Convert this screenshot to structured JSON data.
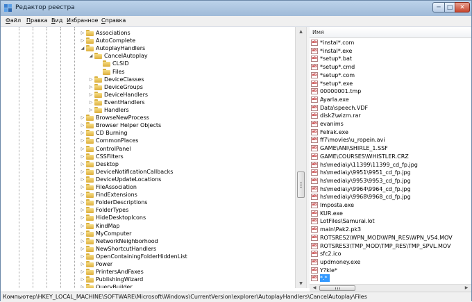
{
  "window": {
    "title": "Редактор реестра",
    "icon": "regedit-icon",
    "controls": {
      "minimize": "─",
      "maximize": "□",
      "close": "✕"
    }
  },
  "menu": [
    "Файл",
    "Правка",
    "Вид",
    "Избранное",
    "Справка"
  ],
  "tree": {
    "items": [
      {
        "label": "Associations",
        "expander": "▷",
        "open": false
      },
      {
        "label": "AutoComplete",
        "expander": "▷",
        "open": false
      },
      {
        "label": "AutoplayHandlers",
        "expander": "◢",
        "open": true
      },
      {
        "label": "CancelAutoplay",
        "expander": "◢",
        "open": true
      },
      {
        "label": "CLSID",
        "expander": "",
        "open": false
      },
      {
        "label": "Files",
        "expander": "",
        "open": true
      },
      {
        "label": "DeviceClasses",
        "expander": "▷",
        "open": false
      },
      {
        "label": "DeviceGroups",
        "expander": "▷",
        "open": false
      },
      {
        "label": "DeviceHandlers",
        "expander": "▷",
        "open": false
      },
      {
        "label": "EventHandlers",
        "expander": "▷",
        "open": false
      },
      {
        "label": "Handlers",
        "expander": "▷",
        "open": false
      },
      {
        "label": "BrowseNewProcess",
        "expander": "▷",
        "open": false
      },
      {
        "label": "Browser Helper Objects",
        "expander": "▷",
        "open": false
      },
      {
        "label": "CD Burning",
        "expander": "▷",
        "open": false
      },
      {
        "label": "CommonPlaces",
        "expander": "▷",
        "open": false
      },
      {
        "label": "ControlPanel",
        "expander": "▷",
        "open": false
      },
      {
        "label": "CSSFilters",
        "expander": "▷",
        "open": false
      },
      {
        "label": "Desktop",
        "expander": "▷",
        "open": false
      },
      {
        "label": "DeviceNotificationCallbacks",
        "expander": "▷",
        "open": false
      },
      {
        "label": "DeviceUpdateLocations",
        "expander": "▷",
        "open": false
      },
      {
        "label": "FileAssociation",
        "expander": "▷",
        "open": false
      },
      {
        "label": "FindExtensions",
        "expander": "▷",
        "open": false
      },
      {
        "label": "FolderDescriptions",
        "expander": "▷",
        "open": false
      },
      {
        "label": "FolderTypes",
        "expander": "▷",
        "open": false
      },
      {
        "label": "HideDesktopIcons",
        "expander": "▷",
        "open": false
      },
      {
        "label": "KindMap",
        "expander": "▷",
        "open": false
      },
      {
        "label": "MyComputer",
        "expander": "▷",
        "open": false
      },
      {
        "label": "NetworkNeighborhood",
        "expander": "▷",
        "open": false
      },
      {
        "label": "NewShortcutHandlers",
        "expander": "▷",
        "open": false
      },
      {
        "label": "OpenContainingFolderHiddenList",
        "expander": "▷",
        "open": false
      },
      {
        "label": "Power",
        "expander": "▷",
        "open": false
      },
      {
        "label": "PrintersAndFaxes",
        "expander": "▷",
        "open": false
      },
      {
        "label": "PublishingWizard",
        "expander": "▷",
        "open": false
      },
      {
        "label": "QueryBuilder",
        "expander": "▷",
        "open": false
      },
      {
        "label": "RecentDocs",
        "expander": "▷",
        "open": false
      }
    ],
    "scroll": {
      "up": "▲",
      "down": "▼"
    }
  },
  "list": {
    "column_name": "Имя",
    "value_icon_text": "ab",
    "values": [
      "*instal*.com",
      "*instal*.exe",
      "*setup*.bat",
      "*setup*.cmd",
      "*setup*.com",
      "*setup*.exe",
      "00000001.tmp",
      "Ayarla.exe",
      "Data\\speech.VDF",
      "disk2\\wizm.rar",
      "evanims",
      "Felrak.exe",
      "ff7\\movies\\u_ropein.avi",
      "GAME\\ANI\\SHIRLE_1.SSF",
      "GAME\\COURSES\\WHISTLER.CRZ",
      "hs\\media\\y\\11399\\11399_cd_fp.jpg",
      "hs\\media\\y\\9951\\9951_cd_fp.jpg",
      "hs\\media\\y\\9953\\9953_cd_fp.jpg",
      "hs\\media\\y\\9964\\9964_cd_fp.jpg",
      "hs\\media\\y\\9968\\9968_cd_fp.jpg",
      "Imposta.exe",
      "KUR.exe",
      "LotFiles\\Samurai.lot",
      "main\\Pak2.pk3",
      "ROTSRES2\\WPN_MOD\\WPN_RES\\WPN_V54.MOV",
      "ROTSRES3\\TMP_MOD\\TMP_RES\\TMP_SPVL.MOV",
      "sfc2.ico",
      "updmoney.exe",
      "Y?kle*"
    ],
    "selected_label": "*.*",
    "hscroll": {
      "left": "◀",
      "right": "▶",
      "grip": "|||"
    }
  },
  "status": "Компьютер\\HKEY_LOCAL_MACHINE\\SOFTWARE\\Microsoft\\Windows\\CurrentVersion\\explorer\\AutoplayHandlers\\CancelAutoplay\\Files"
}
